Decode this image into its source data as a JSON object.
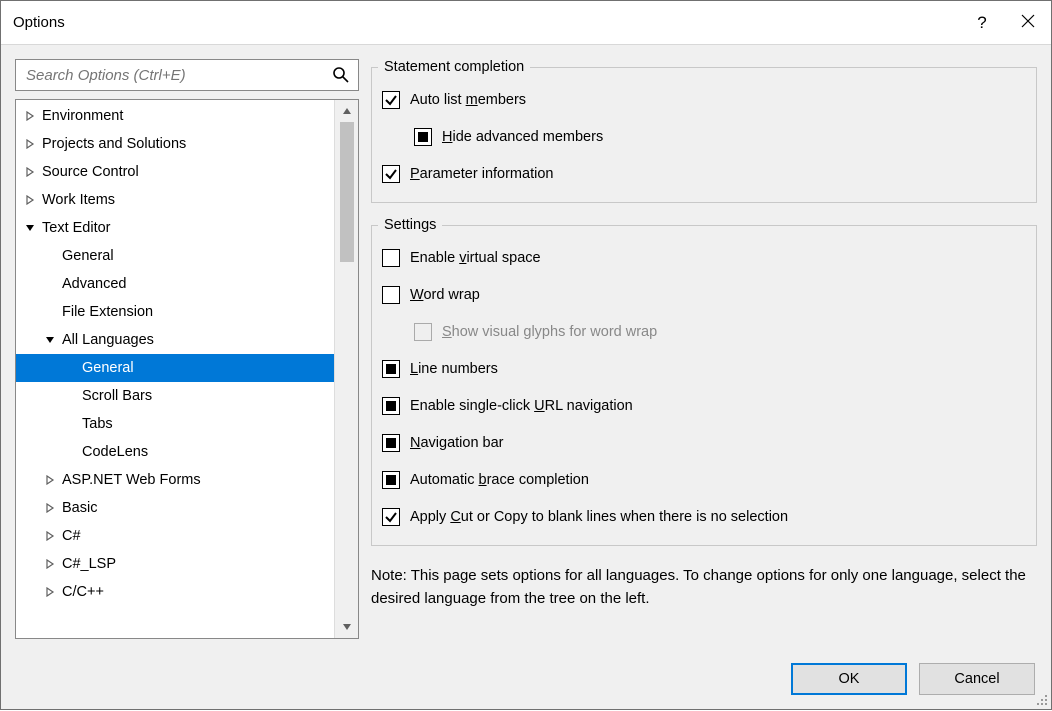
{
  "title": "Options",
  "search": {
    "placeholder": "Search Options (Ctrl+E)"
  },
  "tree": {
    "items": [
      {
        "label": "Environment",
        "level": 0,
        "arrow": "right",
        "selected": false
      },
      {
        "label": "Projects and Solutions",
        "level": 0,
        "arrow": "right",
        "selected": false
      },
      {
        "label": "Source Control",
        "level": 0,
        "arrow": "right",
        "selected": false
      },
      {
        "label": "Work Items",
        "level": 0,
        "arrow": "right",
        "selected": false
      },
      {
        "label": "Text Editor",
        "level": 0,
        "arrow": "down",
        "selected": false
      },
      {
        "label": "General",
        "level": 1,
        "arrow": "none",
        "selected": false
      },
      {
        "label": "Advanced",
        "level": 1,
        "arrow": "none",
        "selected": false
      },
      {
        "label": "File Extension",
        "level": 1,
        "arrow": "none",
        "selected": false
      },
      {
        "label": "All Languages",
        "level": 1,
        "arrow": "down",
        "selected": false
      },
      {
        "label": "General",
        "level": 2,
        "arrow": "none",
        "selected": true
      },
      {
        "label": "Scroll Bars",
        "level": 2,
        "arrow": "none",
        "selected": false
      },
      {
        "label": "Tabs",
        "level": 2,
        "arrow": "none",
        "selected": false
      },
      {
        "label": "CodeLens",
        "level": 2,
        "arrow": "none",
        "selected": false
      },
      {
        "label": "ASP.NET Web Forms",
        "level": 1,
        "arrow": "right",
        "selected": false
      },
      {
        "label": "Basic",
        "level": 1,
        "arrow": "right",
        "selected": false
      },
      {
        "label": "C#",
        "level": 1,
        "arrow": "right",
        "selected": false
      },
      {
        "label": "C#_LSP",
        "level": 1,
        "arrow": "right",
        "selected": false
      },
      {
        "label": "C/C++",
        "level": 1,
        "arrow": "right",
        "selected": false
      }
    ]
  },
  "groups": {
    "statement": {
      "legend": "Statement completion",
      "auto_list": {
        "pre": "Auto list ",
        "u": "m",
        "post": "embers",
        "state": "checked"
      },
      "hide_adv": {
        "pre": "",
        "u": "H",
        "post": "ide advanced members",
        "state": "indeterminate"
      },
      "param_info": {
        "pre": "",
        "u": "P",
        "post": "arameter information",
        "state": "checked"
      }
    },
    "settings": {
      "legend": "Settings",
      "virtual": {
        "pre": "Enable ",
        "u": "v",
        "post": "irtual space",
        "state": "unchecked"
      },
      "wrap": {
        "pre": "",
        "u": "W",
        "post": "ord wrap",
        "state": "unchecked"
      },
      "glyphs": {
        "pre": "",
        "u": "S",
        "post": "how visual glyphs for word wrap",
        "state": "disabled"
      },
      "linenum": {
        "pre": "",
        "u": "L",
        "post": "ine numbers",
        "state": "indeterminate"
      },
      "url": {
        "pre": "Enable single-click ",
        "u": "U",
        "post": "RL navigation",
        "state": "indeterminate"
      },
      "navbar": {
        "pre": "",
        "u": "N",
        "post": "avigation bar",
        "state": "indeterminate"
      },
      "brace": {
        "pre": "Automatic ",
        "u": "b",
        "post": "race completion",
        "state": "indeterminate"
      },
      "cutcopy": {
        "pre": "Apply ",
        "u": "C",
        "post": "ut or Copy to blank lines when there is no selection",
        "state": "checked"
      }
    }
  },
  "note": "Note: This page sets options for all languages. To change options for only one language, select the desired language from the tree on the left.",
  "buttons": {
    "ok": "OK",
    "cancel": "Cancel"
  }
}
